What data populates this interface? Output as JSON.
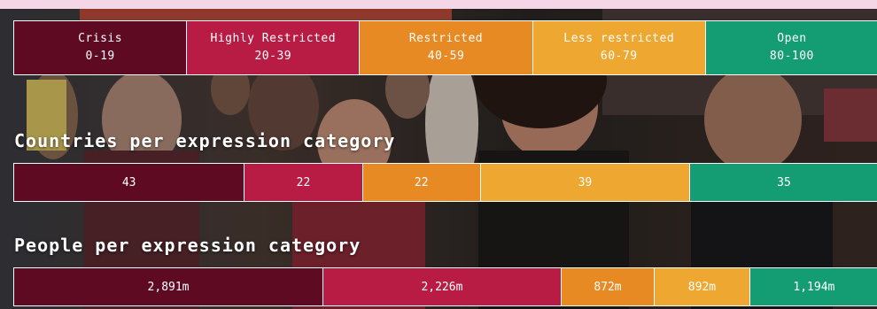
{
  "chart_data": {
    "type": "bar",
    "categories": [
      {
        "name": "Crisis",
        "range": "0-19",
        "color": "#5e0a22"
      },
      {
        "name": "Highly Restricted",
        "range": "20-39",
        "color": "#b81c45"
      },
      {
        "name": "Restricted",
        "range": "40-59",
        "color": "#e88a24"
      },
      {
        "name": "Less restricted",
        "range": "60-79",
        "color": "#eea730"
      },
      {
        "name": "Open",
        "range": "80-100",
        "color": "#149c72"
      }
    ],
    "series": [
      {
        "name": "Countries per expression category",
        "values": [
          43,
          22,
          22,
          39,
          35
        ],
        "labels": [
          "43",
          "22",
          "22",
          "39",
          "35"
        ]
      },
      {
        "name": "People per expression category",
        "values": [
          2891,
          2226,
          872,
          892,
          1194
        ],
        "labels": [
          "2,891m",
          "2,226m",
          "872m",
          "892m",
          "1,194m"
        ]
      }
    ]
  }
}
